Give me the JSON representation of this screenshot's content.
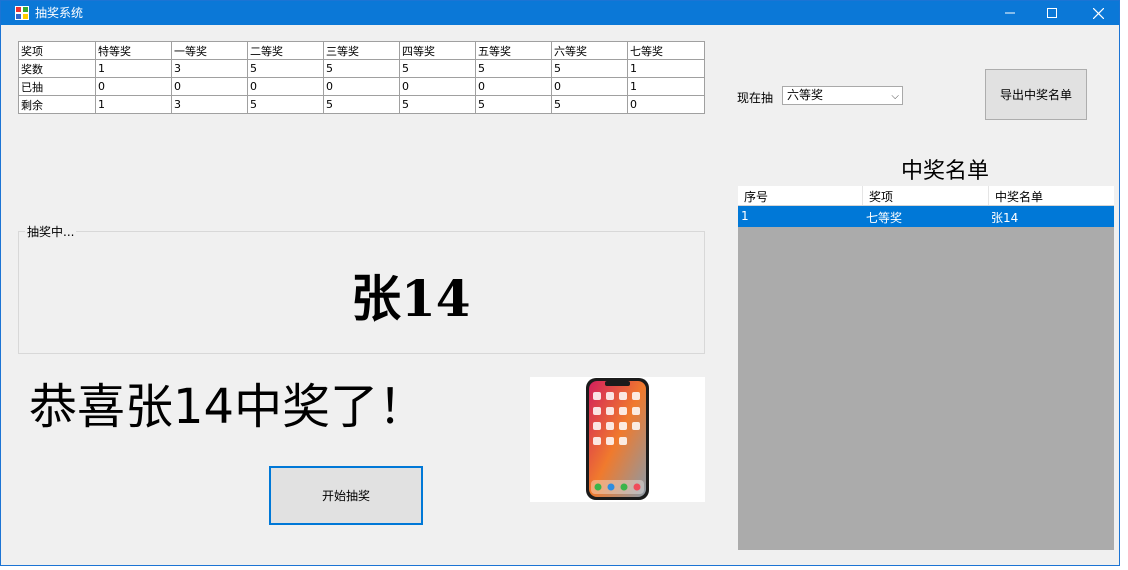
{
  "window": {
    "title": "抽奖系统"
  },
  "prize_table": {
    "rows": [
      [
        "奖项",
        "特等奖",
        "一等奖",
        "二等奖",
        "三等奖",
        "四等奖",
        "五等奖",
        "六等奖",
        "七等奖"
      ],
      [
        "奖数",
        "1",
        "3",
        "5",
        "5",
        "5",
        "5",
        "5",
        "1"
      ],
      [
        "已抽",
        "0",
        "0",
        "0",
        "0",
        "0",
        "0",
        "0",
        "1"
      ],
      [
        "剩余",
        "1",
        "3",
        "5",
        "5",
        "5",
        "5",
        "5",
        "0"
      ]
    ]
  },
  "controls": {
    "current_label": "现在抽",
    "current_prize": "六等奖",
    "export_button": "导出中奖名单",
    "start_button": "开始抽奖"
  },
  "winners": {
    "title": "中奖名单",
    "columns": [
      "序号",
      "奖项",
      "中奖名单"
    ],
    "rows": [
      [
        "1",
        "七等奖",
        "张14"
      ]
    ]
  },
  "draw": {
    "group_caption": "抽奖中...",
    "current_name": "张14",
    "congrats": "恭喜张14中奖了！"
  },
  "colors": {
    "titlebar": "#0b78d7",
    "selection": "#0078d7",
    "list_bg": "#ababab"
  },
  "icons": {
    "prize": "phone-icon",
    "app": "app-icon"
  }
}
